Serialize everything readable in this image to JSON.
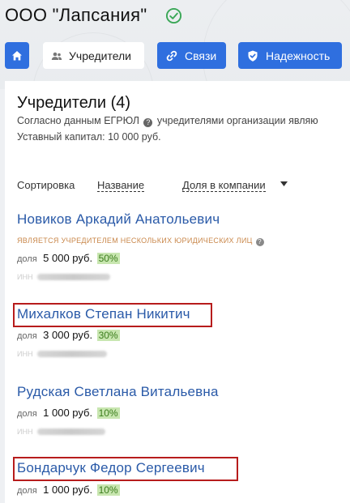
{
  "company": {
    "title": "ООО \"Лапсания\"",
    "verified_icon": "check-circle-icon",
    "verified_color": "#3aa757"
  },
  "nav": {
    "home_icon": "home-icon",
    "founders_label": "Учредители",
    "links_label": "Связи",
    "reliability_label": "Надежность",
    "accent_color": "#2f6fdf"
  },
  "card": {
    "title": "Учредители (4)",
    "source_prefix": "Согласно данным ЕГРЮЛ",
    "source_suffix": "учредителями организации являю",
    "capital": "Уставный капитал: 10 000 руб."
  },
  "sort": {
    "label": "Сортировка",
    "by_name": "Название",
    "by_share": "Доля в компании"
  },
  "founders": [
    {
      "name": "Новиков Аркадий Анатольевич",
      "note": "ЯВЛЯЕТСЯ УЧРЕДИТЕЛЕМ НЕСКОЛЬКИХ ЮРИДИЧЕСКИХ ЛИЦ",
      "share_label": "доля",
      "amount": "5 000 руб.",
      "percent": "50%",
      "inn_label": "ИНН",
      "highlighted": false
    },
    {
      "name": "Михалков Степан Никитич",
      "share_label": "доля",
      "amount": "3 000 руб.",
      "percent": "30%",
      "inn_label": "ИНН",
      "highlighted": true
    },
    {
      "name": "Рудская Светлана Витальевна",
      "share_label": "доля",
      "amount": "1 000 руб.",
      "percent": "10%",
      "inn_label": "ИНН",
      "highlighted": false
    },
    {
      "name": "Бондарчук Федор Сергеевич",
      "share_label": "доля",
      "amount": "1 000 руб.",
      "percent": "10%",
      "highlighted": true
    }
  ],
  "colors": {
    "link": "#2a5aa8",
    "highlight_border": "#b71c1c",
    "percent_bg": "#c8e6b0",
    "note": "#c9874a"
  }
}
